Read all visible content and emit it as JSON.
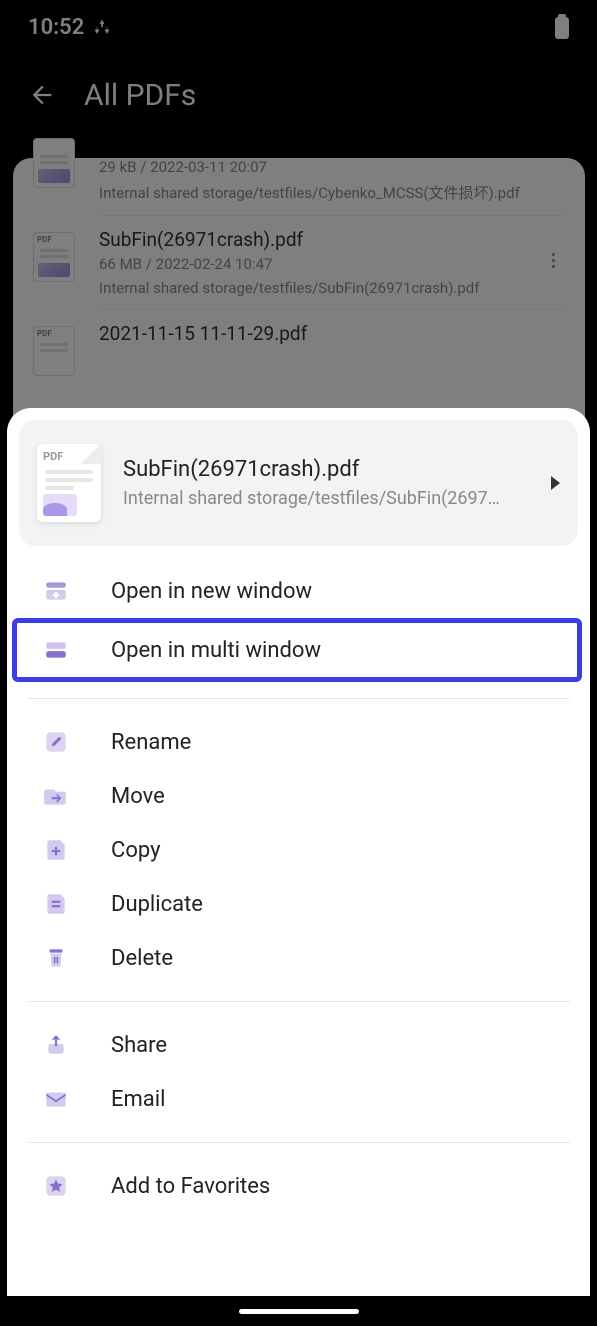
{
  "status": {
    "time": "10:52"
  },
  "header": {
    "title": "All PDFs"
  },
  "files": [
    {
      "name": "",
      "meta": "29 kB / 2022-03-11 20:07",
      "path": "Internal shared storage/testfiles/Cybenko_MCSS(文件损坏).pdf"
    },
    {
      "name": "SubFin(26971crash).pdf",
      "meta": "66 MB / 2022-02-24 10:47",
      "path": "Internal shared storage/testfiles/SubFin(26971crash).pdf"
    },
    {
      "name": "2021-11-15 11-11-29.pdf",
      "meta": "",
      "path": ""
    }
  ],
  "sheet": {
    "file_name": "SubFin(26971crash).pdf",
    "file_path": "Internal shared storage/testfiles/SubFin(2697…",
    "pdf_label": "PDF",
    "menu": {
      "open_new_window": "Open in new window",
      "open_multi_window": "Open in multi window",
      "rename": "Rename",
      "move": "Move",
      "copy": "Copy",
      "duplicate": "Duplicate",
      "delete": "Delete",
      "share": "Share",
      "email": "Email",
      "favorites": "Add to Favorites"
    }
  }
}
